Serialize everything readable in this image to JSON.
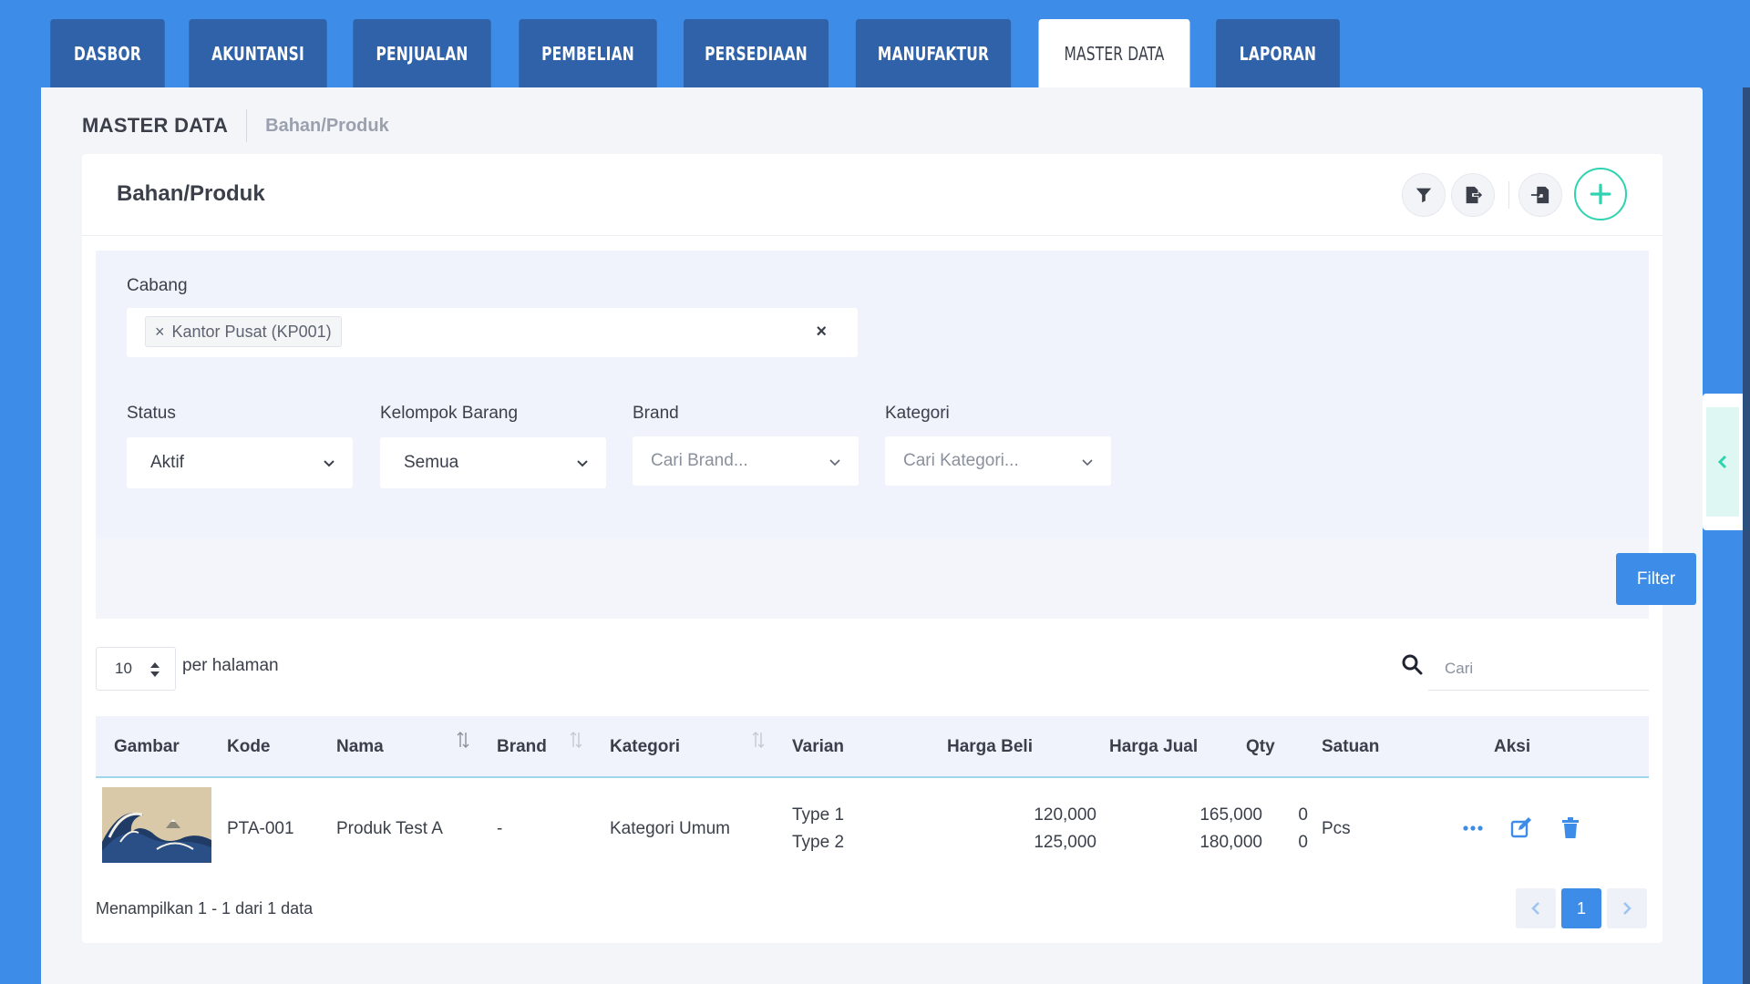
{
  "tabs": [
    {
      "label": "DASBOR",
      "active": false
    },
    {
      "label": "AKUNTANSI",
      "active": false
    },
    {
      "label": "PENJUALAN",
      "active": false
    },
    {
      "label": "PEMBELIAN",
      "active": false
    },
    {
      "label": "PERSEDIAAN",
      "active": false
    },
    {
      "label": "MANUFAKTUR",
      "active": false
    },
    {
      "label": "MASTER DATA",
      "active": true
    },
    {
      "label": "LAPORAN",
      "active": false
    }
  ],
  "page": {
    "title": "MASTER DATA",
    "breadcrumb": "Bahan/Produk"
  },
  "card": {
    "title": "Bahan/Produk"
  },
  "filters": {
    "cabang": {
      "label": "Cabang",
      "selected": "Kantor Pusat (KP001)",
      "chip_remove": "×",
      "clear": "×"
    },
    "status": {
      "label": "Status",
      "value": "Aktif"
    },
    "kelompok": {
      "label": "Kelompok Barang",
      "value": "Semua"
    },
    "brand": {
      "label": "Brand",
      "placeholder": "Cari Brand..."
    },
    "kategori": {
      "label": "Kategori",
      "placeholder": "Cari Kategori..."
    },
    "filter_button": "Filter"
  },
  "list": {
    "per_page_value": "10",
    "per_page_label": "per halaman",
    "search_placeholder": "Cari"
  },
  "table": {
    "columns": [
      "Gambar",
      "Kode",
      "Nama",
      "Brand",
      "Kategori",
      "Varian",
      "Harga Beli",
      "Harga Jual",
      "Qty",
      "Satuan",
      "Aksi"
    ],
    "rows": [
      {
        "kode": "PTA-001",
        "nama": "Produk Test A",
        "brand": "-",
        "kategori": "Kategori Umum",
        "varian": [
          "Type 1",
          "Type 2"
        ],
        "harga_beli": [
          "120,000",
          "125,000"
        ],
        "harga_jual": [
          "165,000",
          "180,000"
        ],
        "qty": [
          "0",
          "0"
        ],
        "satuan": "Pcs"
      }
    ]
  },
  "footer": {
    "info": "Menampilkan 1 - 1 dari 1 data",
    "current_page": "1"
  },
  "colors": {
    "primary": "#3d8ce8",
    "tab": "#2f62a8",
    "accent": "#2fd3b0"
  }
}
